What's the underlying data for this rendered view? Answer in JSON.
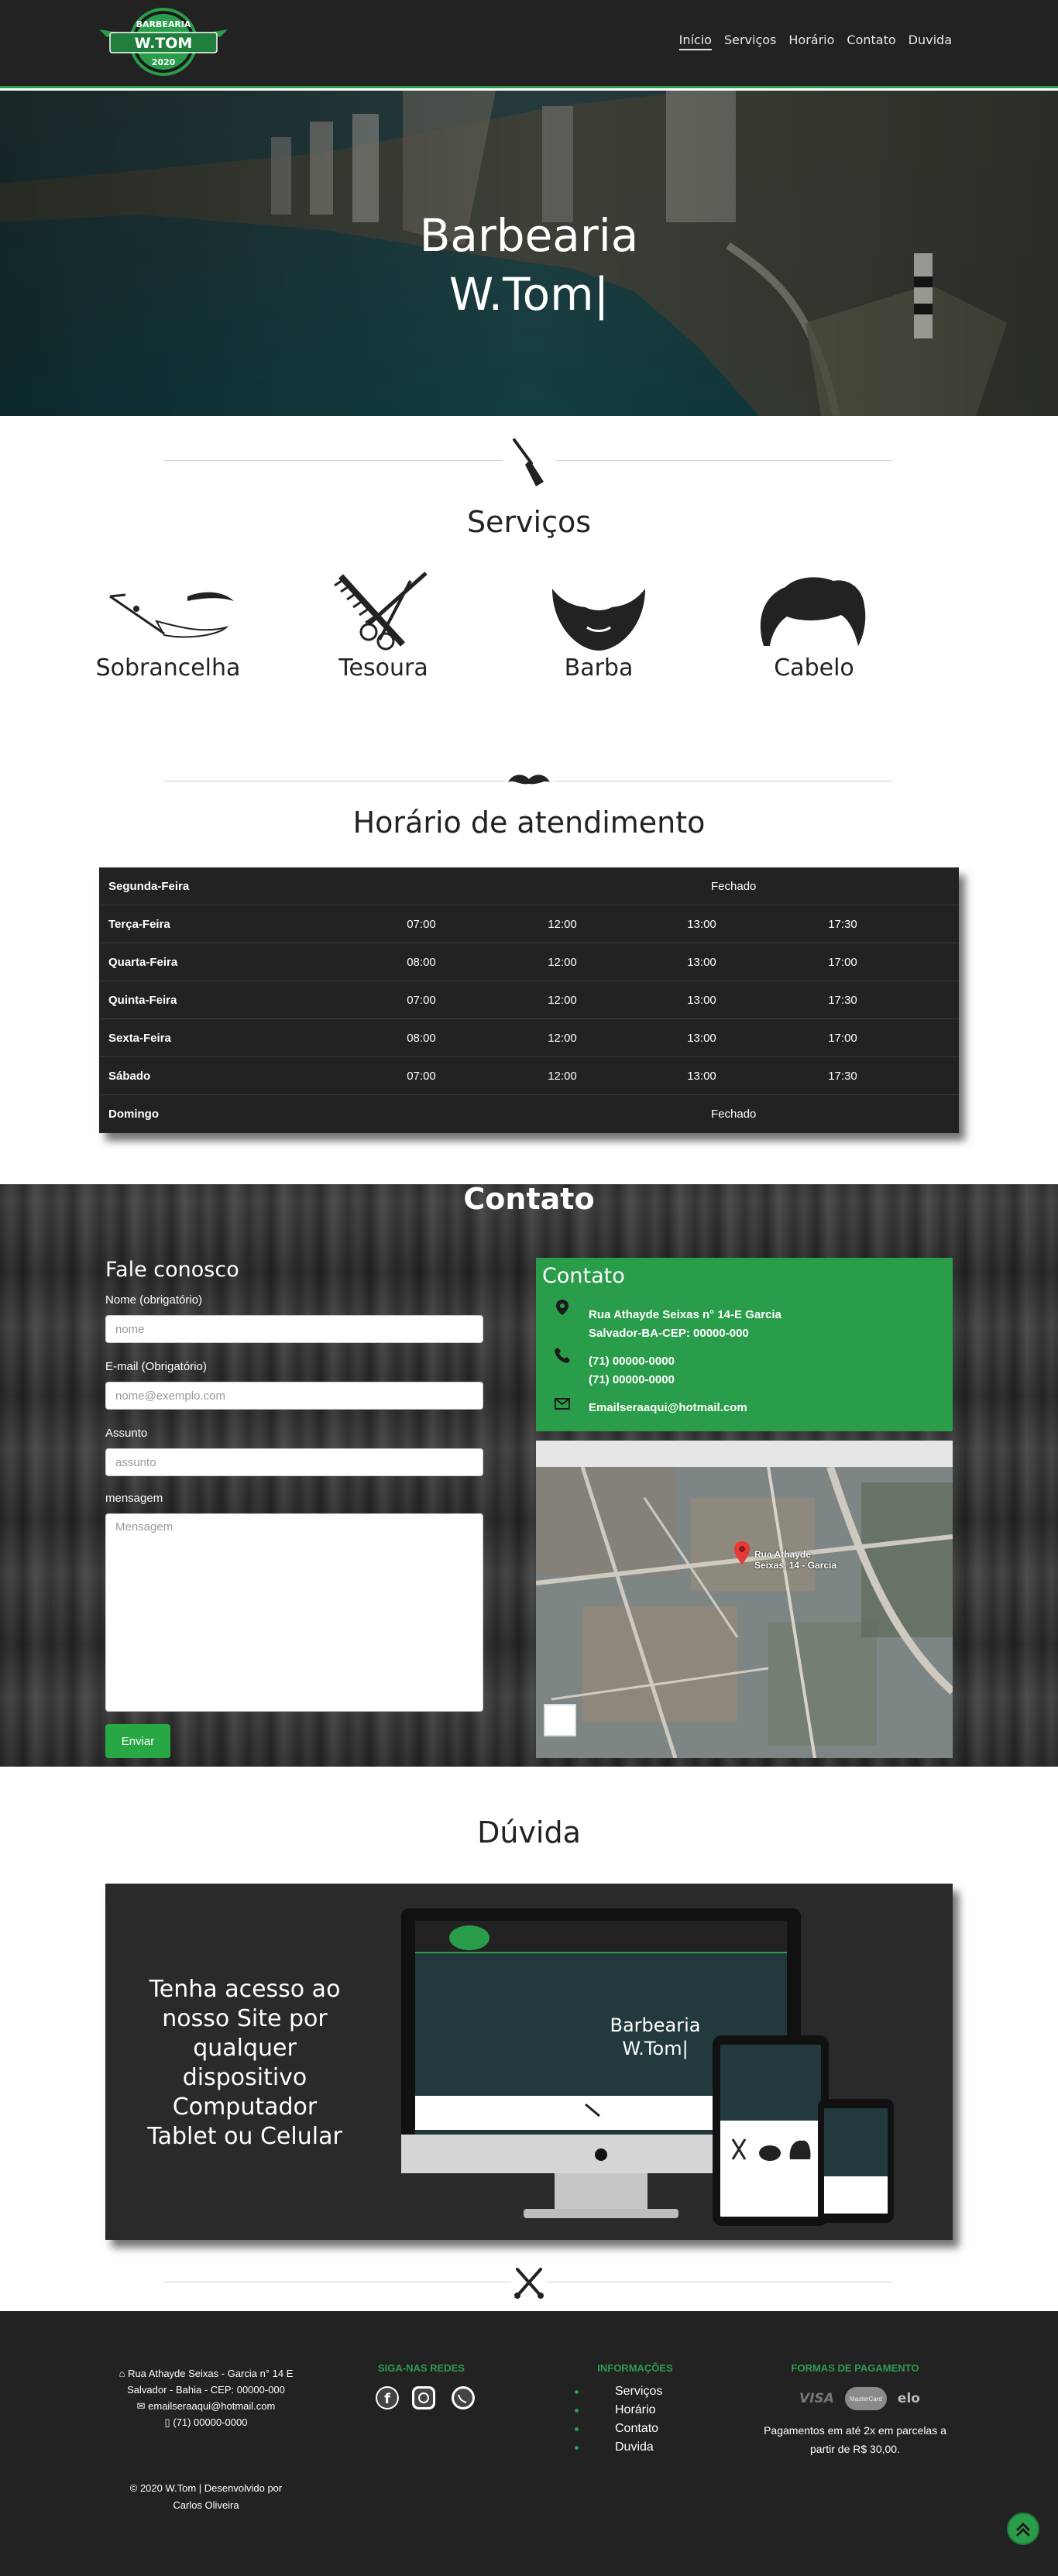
{
  "nav": {
    "logo_top": "BARBEARIA",
    "logo_name": "W.TOM",
    "logo_year": "2020",
    "links": [
      "Início",
      "Serviços",
      "Horário",
      "Contato",
      "Duvida"
    ]
  },
  "hero": {
    "title_line1": "Barbearia",
    "title_line2": "W.Tom|"
  },
  "services": {
    "title": "Serviços",
    "items": [
      {
        "label": "Sobrancelha",
        "icon": "eyebrow-razor-icon"
      },
      {
        "label": "Tesoura",
        "icon": "scissors-comb-icon"
      },
      {
        "label": "Barba",
        "icon": "beard-icon"
      },
      {
        "label": "Cabelo",
        "icon": "hair-icon"
      }
    ]
  },
  "hours": {
    "title": "Horário de atendimento",
    "rows": [
      {
        "day": "Segunda-Feira",
        "closed": "Fechado"
      },
      {
        "day": "Terça-Feira",
        "t1": "07:00",
        "t2": "12:00",
        "t3": "13:00",
        "t4": "17:30"
      },
      {
        "day": "Quarta-Feira",
        "t1": "08:00",
        "t2": "12:00",
        "t3": "13:00",
        "t4": "17:00"
      },
      {
        "day": "Quinta-Feira",
        "t1": "07:00",
        "t2": "12:00",
        "t3": "13:00",
        "t4": "17:30"
      },
      {
        "day": "Sexta-Feira",
        "t1": "08:00",
        "t2": "12:00",
        "t3": "13:00",
        "t4": "17:00"
      },
      {
        "day": "Sábado",
        "t1": "07:00",
        "t2": "12:00",
        "t3": "13:00",
        "t4": "17:30"
      },
      {
        "day": "Domingo",
        "closed": "Fechado"
      }
    ]
  },
  "contact": {
    "title": "Contato",
    "form_title": "Fale conosco",
    "name_label": "Nome (obrigatório)",
    "name_placeholder": "nome",
    "email_label": "E-mail (Obrigatório)",
    "email_placeholder": "nome@exemplo.com",
    "subject_label": "Assunto",
    "subject_placeholder": "assunto",
    "message_label": "mensagem",
    "message_placeholder": "Mensagem",
    "send_label": "Enviar",
    "card_title": "Contato",
    "address_line1": "Rua Athayde Seixas n° 14-E Garcia",
    "address_line2": "Salvador-BA-CEP: 00000-000",
    "phone1": "(71) 00000-0000",
    "phone2": "(71) 00000-0000",
    "email": "Emailseraaqui@hotmail.com",
    "map_pin_label": "Rua Athayde Seixas, 14 - Garcia"
  },
  "duvida": {
    "title": "Dúvida",
    "text_lines": [
      "Tenha acesso ao",
      "nosso Site por",
      "qualquer",
      "dispositivo",
      "Computador",
      "Tablet ou Celular"
    ],
    "mock_title1": "Barbearia",
    "mock_title2": "W.Tom|"
  },
  "footer": {
    "addr_line1": "Rua Athayde Seixas - Garcia n° 14 E",
    "addr_line2": "Salvador - Bahia - CEP: 00000-000",
    "email": "emailseraaqui@hotmail.com",
    "phone": "(71) 00000-0000",
    "social_title": "SIGA-NAS REDES",
    "info_title": "INFORMAÇÕES",
    "info_links": [
      "Serviços",
      "Horário",
      "Contato",
      "Duvida"
    ],
    "pay_title": "FORMAS DE PAGAMENTO",
    "pay_brands": [
      "VISA",
      "MasterCard",
      "elo"
    ],
    "pay_text": "Pagamentos em até 2x em parcelas a partir de R$ 30,00.",
    "copyright_line1": "2020 W.Tom | Desenvolvido por",
    "copyright_line2": "Carlos Oliveira"
  },
  "colors": {
    "brand_green": "#2a9d4b",
    "dark": "#222222"
  }
}
